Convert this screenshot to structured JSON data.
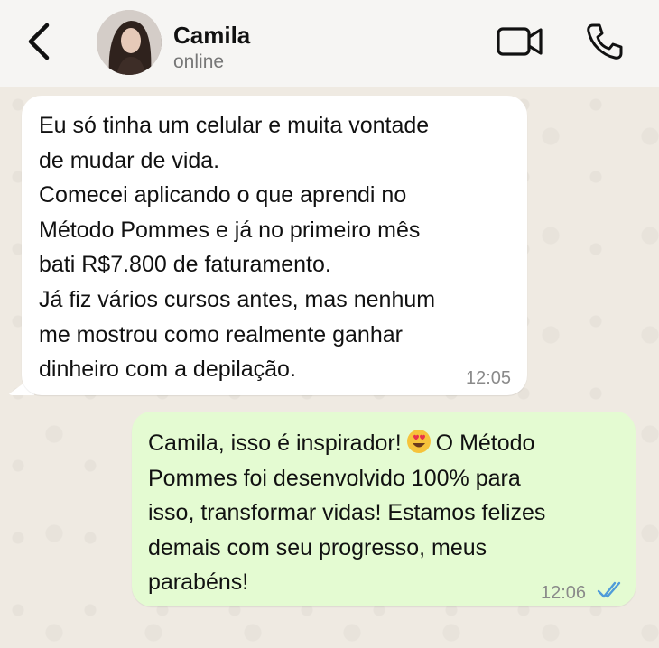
{
  "header": {
    "contact_name": "Camila",
    "contact_status": "online",
    "back_icon": "chevron-left-icon",
    "video_icon": "video-camera-icon",
    "call_icon": "phone-icon"
  },
  "messages": [
    {
      "direction": "incoming",
      "lines": [
        "Eu só tinha um celular e muita vontade",
        "de mudar de vida.",
        "Comecei aplicando o que aprendi no",
        "Método Pommes e já no primeiro mês",
        "bati R$7.800 de faturamento.",
        "Já fiz vários cursos antes, mas nenhum",
        "me mostrou como realmente ganhar",
        "dinheiro com a depilação."
      ],
      "time": "12:05"
    },
    {
      "direction": "outgoing",
      "line1_before_emoji": "Camila, isso é inspirador!",
      "emoji": "heart-eyes-emoji",
      "line1_after_emoji": "O Método",
      "lines": [
        "Pommes foi desenvolvido 100% para",
        "isso, transformar vidas! Estamos felizes",
        "demais com seu progresso, meus",
        "parabéns!"
      ],
      "time": "12:06",
      "status_icon": "double-check-icon"
    }
  ],
  "colors": {
    "header_bg": "#f6f5f3",
    "chat_bg": "#efeae2",
    "incoming_bubble": "#ffffff",
    "outgoing_bubble": "#e4fbd2",
    "read_check": "#4f9bd9"
  }
}
